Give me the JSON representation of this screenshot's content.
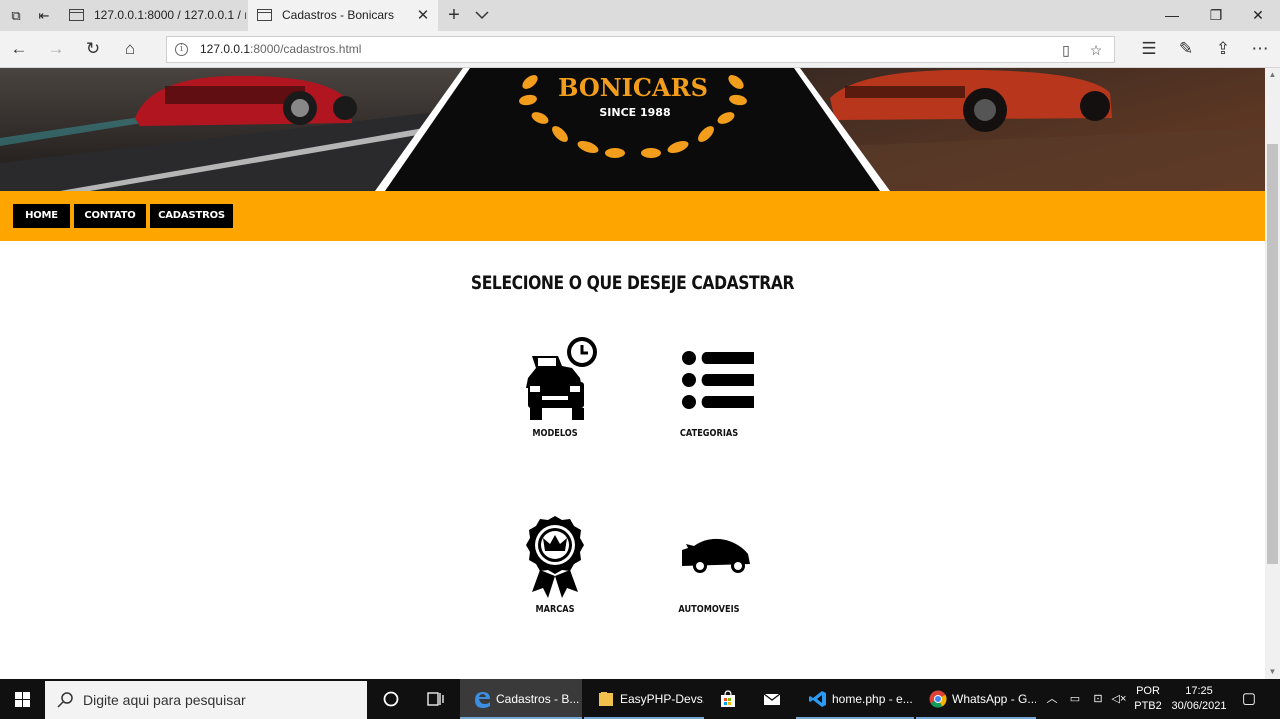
{
  "browser": {
    "tabs": [
      {
        "title": "127.0.0.1:8000 / 127.0.0.1 / ı",
        "active": false
      },
      {
        "title": "Cadastros - Bonicars",
        "active": true
      }
    ],
    "address": {
      "host": "127.0.0.1",
      "path": ":8000/cadastros.html"
    }
  },
  "banner": {
    "brand": "BONICARS",
    "since": "SINCE 1988"
  },
  "menu": {
    "items": [
      "HOME",
      "CONTATO",
      "CADASTROS"
    ]
  },
  "main": {
    "title": "SELECIONE O QUE DESEJE CADASTRAR",
    "cards": [
      {
        "label": "MODELOS",
        "icon": "car-clock-icon"
      },
      {
        "label": "CATEGORIAS",
        "icon": "list-icon"
      },
      {
        "label": "MARCAS",
        "icon": "badge-crown-icon"
      },
      {
        "label": "AUTOMOVEIS",
        "icon": "sports-car-icon"
      }
    ]
  },
  "taskbar": {
    "search_placeholder": "Digite aqui para pesquisar",
    "apps": [
      {
        "label": "Cadastros - B...",
        "icon": "edge-icon"
      },
      {
        "label": "EasyPHP-Devs...",
        "icon": "folder-icon"
      },
      {
        "label": "",
        "icon": "store-icon"
      },
      {
        "label": "",
        "icon": "mail-icon"
      },
      {
        "label": "home.php - e...",
        "icon": "vscode-icon"
      },
      {
        "label": "WhatsApp - G...",
        "icon": "chrome-icon"
      }
    ],
    "language": {
      "line1": "POR",
      "line2": "PTB2"
    },
    "clock": {
      "time": "17:25",
      "date": "30/06/2021"
    }
  },
  "colors": {
    "accent": "#ffa500",
    "menu_button": "#000000",
    "banner_gold": "#f29e1c"
  }
}
